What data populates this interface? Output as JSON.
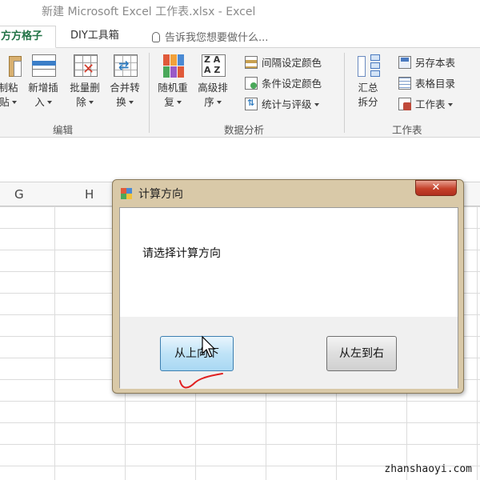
{
  "window": {
    "title": "新建 Microsoft Excel 工作表.xlsx - Excel"
  },
  "tabs": [
    {
      "label": "方方格子",
      "active": true
    },
    {
      "label": "DIY工具箱",
      "active": false
    }
  ],
  "tell_me": {
    "placeholder": "告诉我您想要做什么..."
  },
  "ribbon": {
    "groups": {
      "edit": {
        "label": "编辑",
        "buttons": [
          {
            "line1": "制粘",
            "line2": "贴"
          },
          {
            "line1": "新增插",
            "line2": "入"
          },
          {
            "line1": "批量删",
            "line2": "除"
          },
          {
            "line1": "合并转",
            "line2": "换"
          }
        ]
      },
      "data_analysis": {
        "label": "数据分析",
        "buttons": [
          {
            "line1": "随机重",
            "line2": "复"
          },
          {
            "line1": "高级排",
            "line2": "序"
          }
        ],
        "small_buttons": [
          {
            "label": "间隔设定颜色"
          },
          {
            "label": "条件设定颜色"
          },
          {
            "label": "统计与评级"
          }
        ]
      },
      "worksheet": {
        "label": "工作表",
        "buttons": [
          {
            "line1": "汇总",
            "line2": "拆分"
          }
        ],
        "small_buttons": [
          {
            "label": "另存本表"
          },
          {
            "label": "表格目录"
          },
          {
            "label": "工作表"
          }
        ]
      }
    }
  },
  "grid": {
    "columns": [
      "G",
      "H"
    ]
  },
  "dialog": {
    "title": "计算方向",
    "close_label": "✕",
    "prompt": "请选择计算方向",
    "buttons": {
      "top_to_bottom": "从上向下",
      "left_to_right": "从左到右"
    }
  },
  "watermark": "zhanshaoyi.com",
  "colors": {
    "accent_green": "#217346",
    "dialog_frame": "#d9c9a8",
    "primary_button": "#bfe3f7",
    "close_red": "#c4402a",
    "annotation_red": "#e02020"
  }
}
